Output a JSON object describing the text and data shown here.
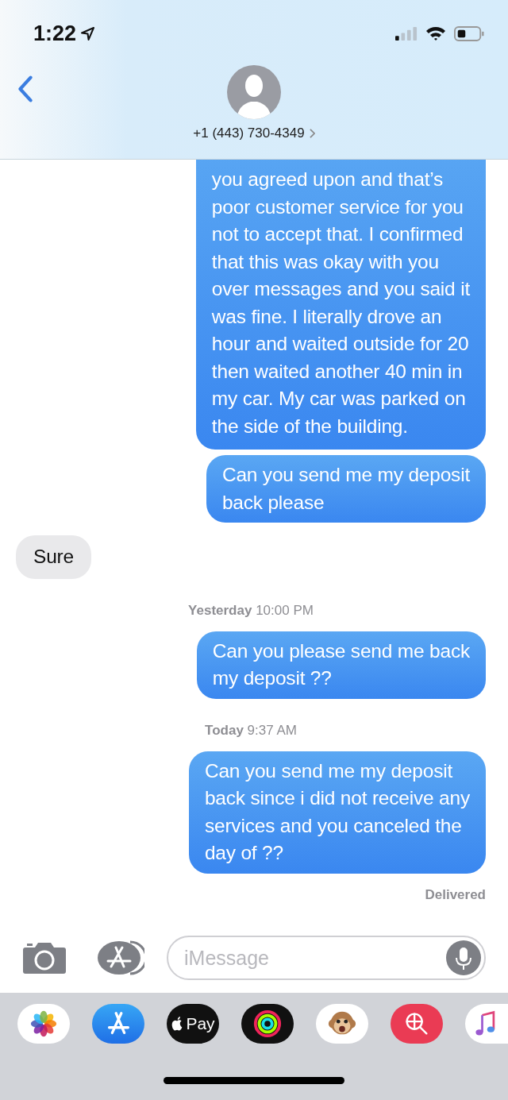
{
  "status_bar": {
    "time": "1:22"
  },
  "contact": {
    "name": "+1 (443) 730-4349"
  },
  "messages": [
    {
      "kind": "sent",
      "text": "you agreed upon and that’s\npoor customer service for you\nnot to accept that. I confirmed\nthat this was okay with you\nover messages and you said it\nwas fine. I literally drove an\nhour and waited outside for 20\nthen waited another 40 min in\nmy car. My car was parked on\nthe side of the building."
    },
    {
      "kind": "sent",
      "text": "Can you send me my deposit\nback please"
    },
    {
      "kind": "received",
      "text": "Sure"
    },
    {
      "kind": "timestamp",
      "text": "**Yesterday** 10:00 PM"
    },
    {
      "kind": "sent",
      "text": "Can you please send me back\nmy deposit ??"
    },
    {
      "kind": "timestamp",
      "text": "**Today** 9:37 AM"
    },
    {
      "kind": "sent",
      "text": "Can you send me my deposit\nback since i did not receive any\nservices and you canceled the\nday of ??"
    },
    {
      "kind": "status",
      "text": "Delivered"
    }
  ],
  "composer": {
    "placeholder": "iMessage"
  },
  "app_drawer": [
    {
      "kind": "photos"
    },
    {
      "kind": "appstore"
    },
    {
      "kind": "pay",
      "label": "Pay"
    },
    {
      "kind": "activity"
    },
    {
      "kind": "animoji"
    },
    {
      "kind": "search"
    },
    {
      "kind": "music"
    }
  ]
}
